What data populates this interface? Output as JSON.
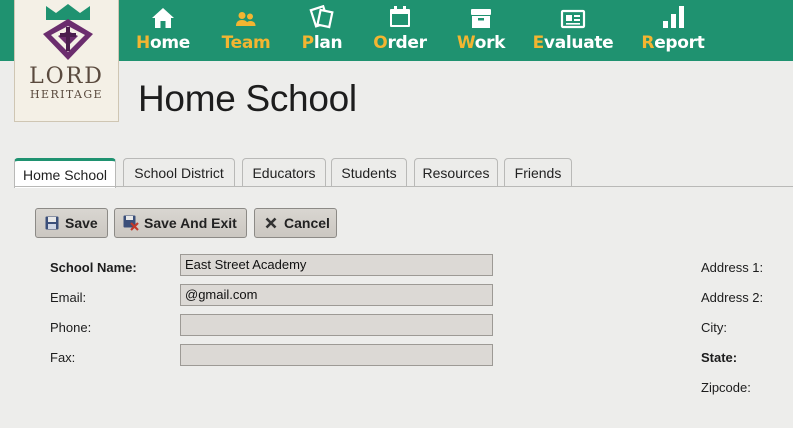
{
  "logo": {
    "line1": "LORD",
    "line2": "HERITAGE"
  },
  "nav": [
    {
      "label_first": "H",
      "label_rest": "ome",
      "icon": "home-icon",
      "active": false
    },
    {
      "label_first": "T",
      "label_rest": "eam",
      "icon": "team-icon",
      "active": true
    },
    {
      "label_first": "P",
      "label_rest": "lan",
      "icon": "plan-icon",
      "active": false
    },
    {
      "label_first": "O",
      "label_rest": "rder",
      "icon": "calendar-icon",
      "active": false
    },
    {
      "label_first": "W",
      "label_rest": "ork",
      "icon": "work-box-icon",
      "active": false
    },
    {
      "label_first": "E",
      "label_rest": "valuate",
      "icon": "id-card-icon",
      "active": false
    },
    {
      "label_first": "R",
      "label_rest": "eport",
      "icon": "bar-chart-icon",
      "active": false
    }
  ],
  "page_title": "Home School",
  "tabs": [
    {
      "label": "Home School",
      "active": true
    },
    {
      "label": "School District",
      "active": false
    },
    {
      "label": "Educators",
      "active": false
    },
    {
      "label": "Students",
      "active": false
    },
    {
      "label": "Resources",
      "active": false
    },
    {
      "label": "Friends",
      "active": false
    }
  ],
  "toolbar": {
    "save": "Save",
    "save_exit": "Save And Exit",
    "cancel": "Cancel"
  },
  "form": {
    "school_name_label": "School Name:",
    "school_name_value": "East Street Academy",
    "email_label": "Email:",
    "email_value": "@gmail.com",
    "phone_label": "Phone:",
    "phone_value": "",
    "fax_label": "Fax:",
    "fax_value": "",
    "address1_label": "Address 1:",
    "address2_label": "Address 2:",
    "city_label": "City:",
    "state_label": "State:",
    "zipcode_label": "Zipcode:"
  },
  "colors": {
    "nav_bg": "#1f9270",
    "nav_accent": "#f3b531",
    "logo_purple": "#6b2d6e",
    "logo_crown": "#1f9270"
  }
}
